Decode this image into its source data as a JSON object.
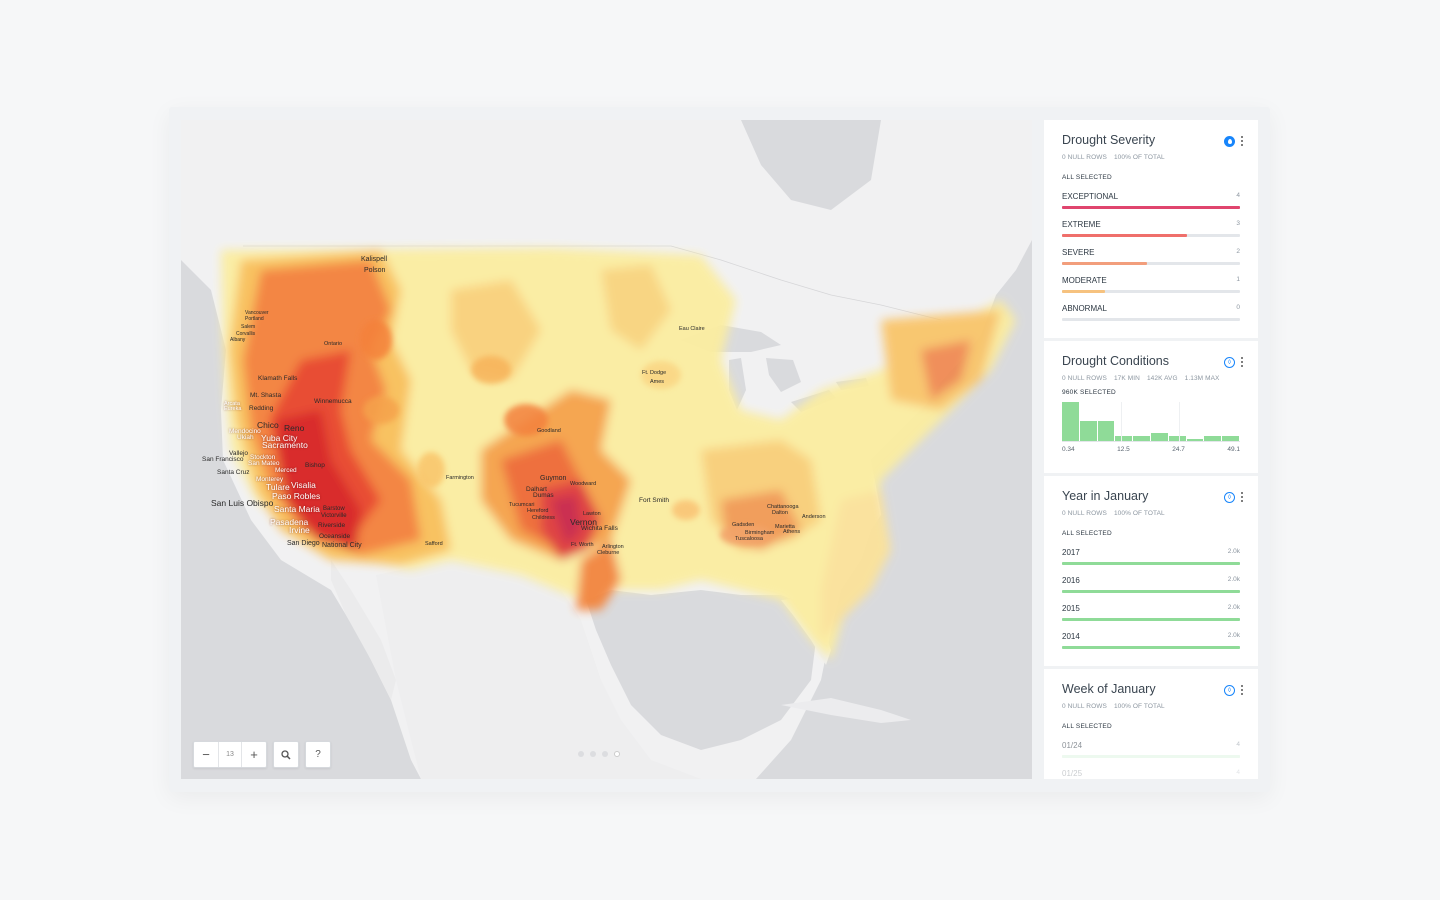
{
  "map": {
    "zoom": "13",
    "zoom_out_label": "−",
    "zoom_in_label": "+",
    "search_icon": "search-icon",
    "help_label": "?",
    "cities": [
      {
        "name": "Kalispell"
      },
      {
        "name": "Polson"
      },
      {
        "name": "Vancouver"
      },
      {
        "name": "Portland"
      },
      {
        "name": "Salem"
      },
      {
        "name": "Corvallis"
      },
      {
        "name": "Albany"
      },
      {
        "name": "Ontario"
      },
      {
        "name": "Klamath Falls"
      },
      {
        "name": "Mt. Shasta"
      },
      {
        "name": "Arcata"
      },
      {
        "name": "Eureka"
      },
      {
        "name": "Redding"
      },
      {
        "name": "Winnemucca"
      },
      {
        "name": "Chico"
      },
      {
        "name": "Reno"
      },
      {
        "name": "Mendocino"
      },
      {
        "name": "Ukiah"
      },
      {
        "name": "Yuba City"
      },
      {
        "name": "Sacramento"
      },
      {
        "name": "Vallejo"
      },
      {
        "name": "San Francisco"
      },
      {
        "name": "Stockton"
      },
      {
        "name": "San Mateo"
      },
      {
        "name": "Bishop"
      },
      {
        "name": "Santa Cruz"
      },
      {
        "name": "Merced"
      },
      {
        "name": "Monterey"
      },
      {
        "name": "Tulare"
      },
      {
        "name": "Visalia"
      },
      {
        "name": "Paso Robles"
      },
      {
        "name": "San Luis Obispo"
      },
      {
        "name": "Santa Maria"
      },
      {
        "name": "Barstow"
      },
      {
        "name": "Victorville"
      },
      {
        "name": "Pasadena"
      },
      {
        "name": "Riverside"
      },
      {
        "name": "Irvine"
      },
      {
        "name": "Oceanside"
      },
      {
        "name": "San Diego"
      },
      {
        "name": "National City"
      },
      {
        "name": "Safford"
      },
      {
        "name": "Farmington"
      },
      {
        "name": "Goodland"
      },
      {
        "name": "Guymon"
      },
      {
        "name": "Woodward"
      },
      {
        "name": "Dalhart"
      },
      {
        "name": "Dumas"
      },
      {
        "name": "Tucumcari"
      },
      {
        "name": "Hereford"
      },
      {
        "name": "Childress"
      },
      {
        "name": "Vernon"
      },
      {
        "name": "Lawton"
      },
      {
        "name": "Wichita Falls"
      },
      {
        "name": "Ft. Worth"
      },
      {
        "name": "Arlington"
      },
      {
        "name": "Cleburne"
      },
      {
        "name": "Fort Smith"
      },
      {
        "name": "Eau Claire"
      },
      {
        "name": "Ft. Dodge"
      },
      {
        "name": "Ames"
      },
      {
        "name": "Chattanooga"
      },
      {
        "name": "Dalton"
      },
      {
        "name": "Gadsden"
      },
      {
        "name": "Anderson"
      },
      {
        "name": "Marietta"
      },
      {
        "name": "Birmingham"
      },
      {
        "name": "Athens"
      },
      {
        "name": "Tuscaloosa"
      }
    ]
  },
  "widgets": {
    "severity": {
      "title": "Drought Severity",
      "null_rows": "0 NULL ROWS",
      "pct_total": "100% OF TOTAL",
      "selected": "ALL SELECTED",
      "items": [
        {
          "label": "EXCEPTIONAL",
          "count": "4",
          "fraction": 1.0,
          "color": "#e0456e"
        },
        {
          "label": "EXTREME",
          "count": "3",
          "fraction": 0.7,
          "color": "#ef6f6b"
        },
        {
          "label": "SEVERE",
          "count": "2",
          "fraction": 0.48,
          "color": "#f29e7c"
        },
        {
          "label": "MODERATE",
          "count": "1",
          "fraction": 0.24,
          "color": "#f6c27f"
        },
        {
          "label": "ABNORMAL",
          "count": "0",
          "fraction": 0.0,
          "color": "#f7dc8a"
        }
      ]
    },
    "conditions": {
      "title": "Drought Conditions",
      "null_rows": "0 NULL ROWS",
      "min": "17K MIN",
      "avg": "142K AVG",
      "max": "1.13M MAX",
      "selected": "960K SELECTED",
      "ticks": [
        "0.34",
        "12.5",
        "24.7",
        "49.1"
      ],
      "histogram": [
        0.97,
        0.5,
        0.5,
        0.12,
        0.12,
        0.2,
        0.12,
        0.04,
        0.12,
        0.12
      ],
      "color": "#8fdb98"
    },
    "year": {
      "title": "Year in January",
      "null_rows": "0 NULL ROWS",
      "pct_total": "100% OF TOTAL",
      "selected": "ALL SELECTED",
      "items": [
        {
          "label": "2017",
          "count": "2.0k",
          "fraction": 1.0,
          "color": "#8fdb98"
        },
        {
          "label": "2016",
          "count": "2.0k",
          "fraction": 1.0,
          "color": "#8fdb98"
        },
        {
          "label": "2015",
          "count": "2.0k",
          "fraction": 1.0,
          "color": "#8fdb98"
        },
        {
          "label": "2014",
          "count": "2.0k",
          "fraction": 1.0,
          "color": "#8fdb98"
        }
      ]
    },
    "week": {
      "title": "Week of January",
      "null_rows": "0 NULL ROWS",
      "pct_total": "100% OF TOTAL",
      "selected": "ALL SELECTED",
      "items": [
        {
          "label": "01/24",
          "count": "4",
          "fraction": 1.0,
          "color": "#dff5e2"
        },
        {
          "label": "01/25",
          "count": "4",
          "fraction": 1.0,
          "color": "#eef9f0"
        }
      ]
    }
  }
}
